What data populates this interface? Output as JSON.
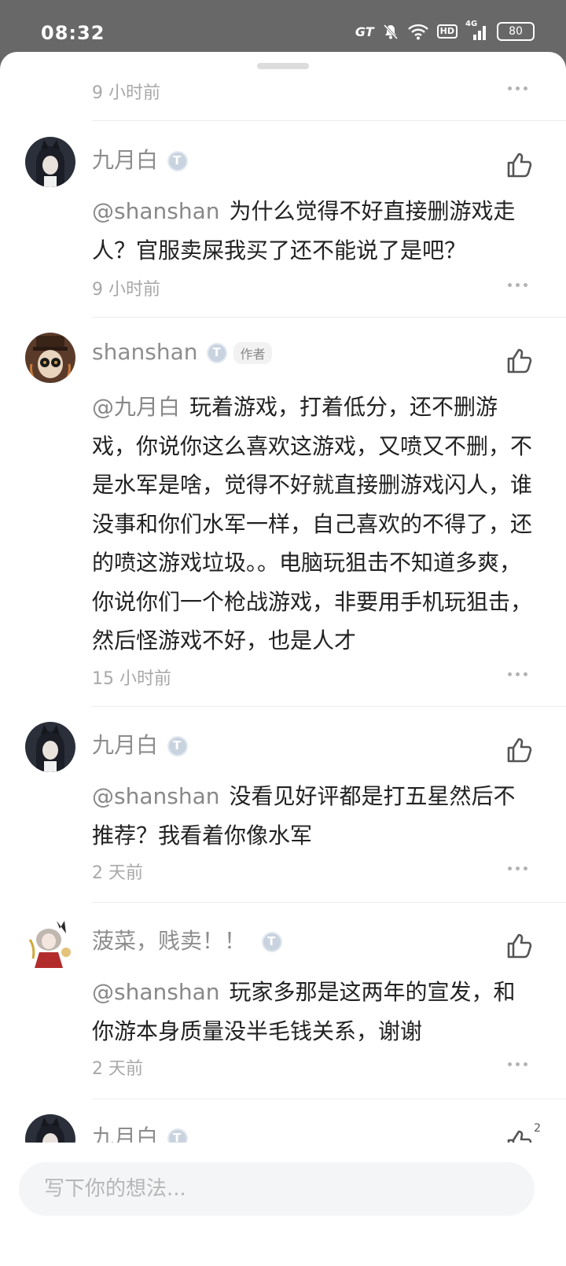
{
  "status_bar": {
    "time": "08:32",
    "network": "GT",
    "hd": "HD",
    "signal": "4G",
    "battery": "80",
    "icons": [
      "gt-icon",
      "mute-bell-icon",
      "wifi-icon",
      "hd-icon",
      "cellular-signal-icon",
      "battery-icon"
    ]
  },
  "first_time": "9 小时前",
  "comments": [
    {
      "name": "九月白",
      "author_tag": "",
      "mention": "@shanshan",
      "text": "为什么觉得不好直接删游戏走人？官服卖屎我买了还不能说了是吧？",
      "time": "9 小时前"
    },
    {
      "name": "shanshan",
      "author_tag": "作者",
      "mention": "@九月白",
      "text": "玩着游戏，打着低分，还不删游戏，你说你这么喜欢这游戏，又喷又不删，不是水军是啥，觉得不好就直接删游戏闪人，谁没事和你们水军一样，自己喜欢的不得了，还的喷这游戏垃圾。。电脑玩狙击不知道多爽，你说你们一个枪战游戏，非要用手机玩狙击，然后怪游戏不好，也是人才",
      "time": "15 小时前"
    },
    {
      "name": "九月白",
      "author_tag": "",
      "mention": "@shanshan",
      "text": "没看见好评都是打五星然后不推荐？我看着你像水军",
      "time": "2 天前"
    },
    {
      "name": "菠菜，贱卖！！",
      "author_tag": "",
      "mention": "@shanshan",
      "text": "玩家多那是这两年的宣发，和你游本身质量没半毛钱关系，谢谢",
      "time": "2 天前"
    },
    {
      "name": "九月白",
      "author_tag": "",
      "like_count": "2"
    }
  ],
  "input": {
    "placeholder": "写下你的想法..."
  },
  "colors": {
    "status_bar_bg": "#686868",
    "sheet_bg": "#ffffff",
    "text_primary": "#222222",
    "text_secondary": "#8d8d8d",
    "input_bg": "#f4f5f7"
  }
}
